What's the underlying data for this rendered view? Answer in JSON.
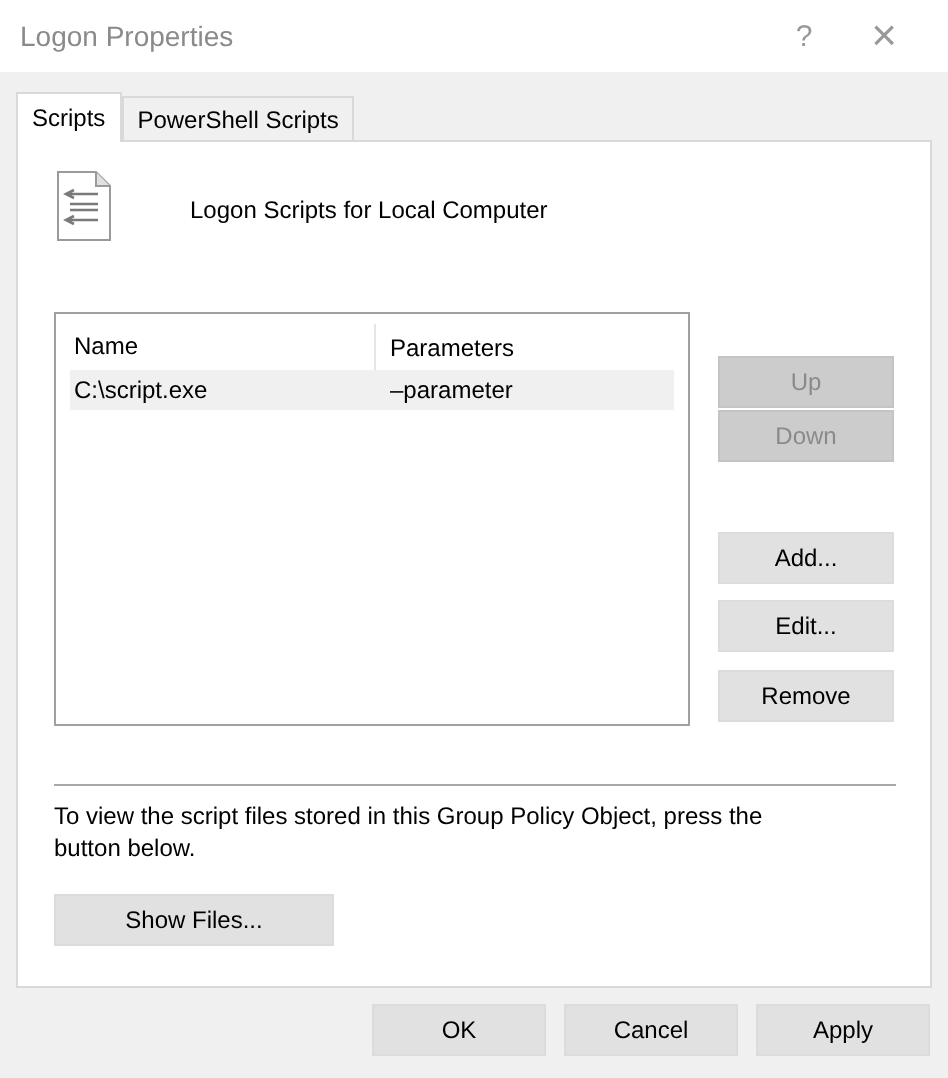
{
  "window": {
    "title": "Logon Properties",
    "help": "?",
    "close": "×"
  },
  "tabs": [
    {
      "label": "Scripts",
      "selected": true
    },
    {
      "label": "PowerShell Scripts",
      "selected": false
    }
  ],
  "heading": "Logon Scripts for Local Computer",
  "table": {
    "columns": [
      "Name",
      "Parameters"
    ],
    "rows": [
      {
        "cells": [
          "C:\\script.exe",
          "–parameter"
        ],
        "selected": true
      }
    ]
  },
  "side_buttons": [
    {
      "label": "Up",
      "disabled": true
    },
    {
      "label": "Down",
      "disabled": true
    },
    {
      "label": "Add...",
      "disabled": false
    },
    {
      "label": "Edit...",
      "disabled": false
    },
    {
      "label": "Remove",
      "disabled": false
    }
  ],
  "info": "To view the script files stored in this Group Policy Object, press the button below.",
  "show_files": "Show Files...",
  "buttons": [
    "OK",
    "Cancel",
    "Apply"
  ]
}
